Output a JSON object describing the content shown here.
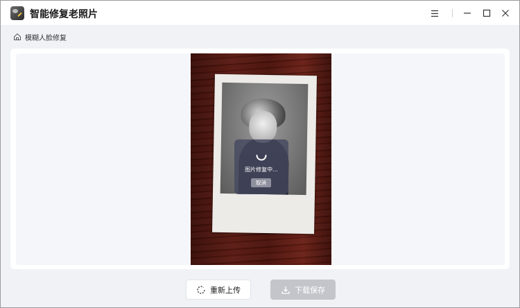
{
  "app": {
    "title": "智能修复老照片",
    "icon": "app-photo-icon"
  },
  "window_controls": {
    "menu_icon": "menu-icon",
    "minimize_icon": "minimize-icon",
    "maximize_icon": "maximize-icon",
    "close_icon": "close-icon"
  },
  "breadcrumb": {
    "icon": "home-icon",
    "label": "模糊人脸修复"
  },
  "processing": {
    "status": "图片修复中...",
    "cancel_label": "取消"
  },
  "actions": {
    "reupload_label": "重新上传",
    "download_label": "下载保存"
  },
  "colors": {
    "background": "#f1f2f6",
    "overlay": "#46485f",
    "disabled_button": "#c3c5cb"
  }
}
